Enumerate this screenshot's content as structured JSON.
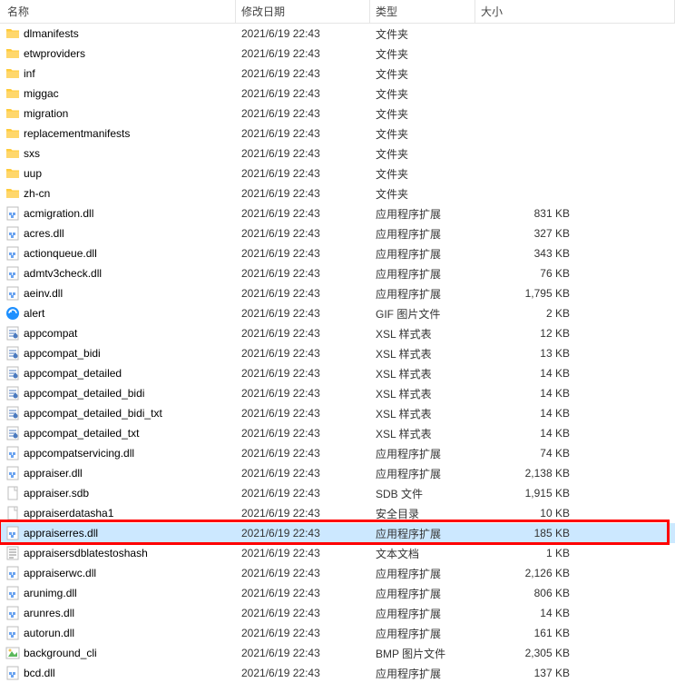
{
  "columns": {
    "name": "名称",
    "date": "修改日期",
    "type": "类型",
    "size": "大小"
  },
  "iconTypes": {
    "folder": "folder",
    "dll": "dll",
    "gif": "gif",
    "xsl": "xsl",
    "sdb": "generic",
    "security": "generic",
    "txt": "txt",
    "cli": "cli",
    "bmp": "bmp"
  },
  "rows": [
    {
      "icon": "folder",
      "name": "dlmanifests",
      "date": "2021/6/19 22:43",
      "type": "文件夹",
      "size": ""
    },
    {
      "icon": "folder",
      "name": "etwproviders",
      "date": "2021/6/19 22:43",
      "type": "文件夹",
      "size": ""
    },
    {
      "icon": "folder",
      "name": "inf",
      "date": "2021/6/19 22:43",
      "type": "文件夹",
      "size": ""
    },
    {
      "icon": "folder",
      "name": "miggac",
      "date": "2021/6/19 22:43",
      "type": "文件夹",
      "size": ""
    },
    {
      "icon": "folder",
      "name": "migration",
      "date": "2021/6/19 22:43",
      "type": "文件夹",
      "size": ""
    },
    {
      "icon": "folder",
      "name": "replacementmanifests",
      "date": "2021/6/19 22:43",
      "type": "文件夹",
      "size": ""
    },
    {
      "icon": "folder",
      "name": "sxs",
      "date": "2021/6/19 22:43",
      "type": "文件夹",
      "size": ""
    },
    {
      "icon": "folder",
      "name": "uup",
      "date": "2021/6/19 22:43",
      "type": "文件夹",
      "size": ""
    },
    {
      "icon": "folder",
      "name": "zh-cn",
      "date": "2021/6/19 22:43",
      "type": "文件夹",
      "size": ""
    },
    {
      "icon": "dll",
      "name": "acmigration.dll",
      "date": "2021/6/19 22:43",
      "type": "应用程序扩展",
      "size": "831 KB"
    },
    {
      "icon": "dll",
      "name": "acres.dll",
      "date": "2021/6/19 22:43",
      "type": "应用程序扩展",
      "size": "327 KB"
    },
    {
      "icon": "dll",
      "name": "actionqueue.dll",
      "date": "2021/6/19 22:43",
      "type": "应用程序扩展",
      "size": "343 KB"
    },
    {
      "icon": "dll",
      "name": "admtv3check.dll",
      "date": "2021/6/19 22:43",
      "type": "应用程序扩展",
      "size": "76 KB"
    },
    {
      "icon": "dll",
      "name": "aeinv.dll",
      "date": "2021/6/19 22:43",
      "type": "应用程序扩展",
      "size": "1,795 KB"
    },
    {
      "icon": "gif",
      "name": "alert",
      "date": "2021/6/19 22:43",
      "type": "GIF 图片文件",
      "size": "2 KB"
    },
    {
      "icon": "xsl",
      "name": "appcompat",
      "date": "2021/6/19 22:43",
      "type": "XSL 样式表",
      "size": "12 KB"
    },
    {
      "icon": "xsl",
      "name": "appcompat_bidi",
      "date": "2021/6/19 22:43",
      "type": "XSL 样式表",
      "size": "13 KB"
    },
    {
      "icon": "xsl",
      "name": "appcompat_detailed",
      "date": "2021/6/19 22:43",
      "type": "XSL 样式表",
      "size": "14 KB"
    },
    {
      "icon": "xsl",
      "name": "appcompat_detailed_bidi",
      "date": "2021/6/19 22:43",
      "type": "XSL 样式表",
      "size": "14 KB"
    },
    {
      "icon": "xsl",
      "name": "appcompat_detailed_bidi_txt",
      "date": "2021/6/19 22:43",
      "type": "XSL 样式表",
      "size": "14 KB"
    },
    {
      "icon": "xsl",
      "name": "appcompat_detailed_txt",
      "date": "2021/6/19 22:43",
      "type": "XSL 样式表",
      "size": "14 KB"
    },
    {
      "icon": "dll",
      "name": "appcompatservicing.dll",
      "date": "2021/6/19 22:43",
      "type": "应用程序扩展",
      "size": "74 KB"
    },
    {
      "icon": "dll",
      "name": "appraiser.dll",
      "date": "2021/6/19 22:43",
      "type": "应用程序扩展",
      "size": "2,138 KB"
    },
    {
      "icon": "generic",
      "name": "appraiser.sdb",
      "date": "2021/6/19 22:43",
      "type": "SDB 文件",
      "size": "1,915 KB"
    },
    {
      "icon": "generic",
      "name": "appraiserdatasha1",
      "date": "2021/6/19 22:43",
      "type": "安全目录",
      "size": "10 KB"
    },
    {
      "icon": "dll",
      "name": "appraiserres.dll",
      "date": "2021/6/19 22:43",
      "type": "应用程序扩展",
      "size": "185 KB",
      "selected": true,
      "highlighted": true
    },
    {
      "icon": "txt",
      "name": "appraisersdblatestoshash",
      "date": "2021/6/19 22:43",
      "type": "文本文档",
      "size": "1 KB"
    },
    {
      "icon": "dll",
      "name": "appraiserwc.dll",
      "date": "2021/6/19 22:43",
      "type": "应用程序扩展",
      "size": "2,126 KB"
    },
    {
      "icon": "dll",
      "name": "arunimg.dll",
      "date": "2021/6/19 22:43",
      "type": "应用程序扩展",
      "size": "806 KB"
    },
    {
      "icon": "dll",
      "name": "arunres.dll",
      "date": "2021/6/19 22:43",
      "type": "应用程序扩展",
      "size": "14 KB"
    },
    {
      "icon": "dll",
      "name": "autorun.dll",
      "date": "2021/6/19 22:43",
      "type": "应用程序扩展",
      "size": "161 KB"
    },
    {
      "icon": "bmp",
      "name": "background_cli",
      "date": "2021/6/19 22:43",
      "type": "BMP 图片文件",
      "size": "2,305 KB"
    },
    {
      "icon": "dll",
      "name": "bcd.dll",
      "date": "2021/6/19 22:43",
      "type": "应用程序扩展",
      "size": "137 KB"
    }
  ]
}
